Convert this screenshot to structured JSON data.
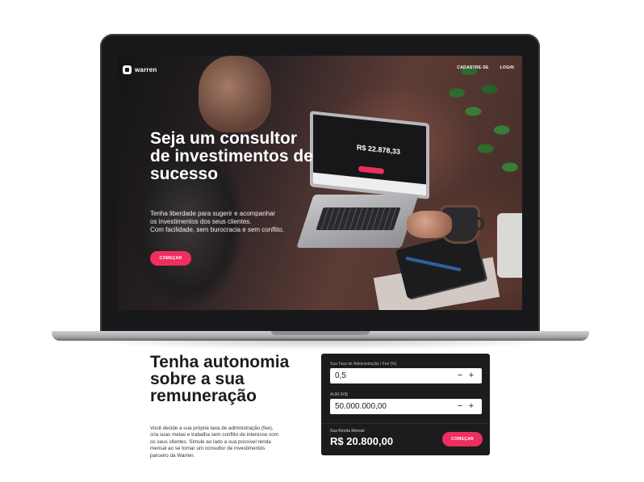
{
  "nav": {
    "brand": "warren",
    "links": [
      "CADASTRE-SE",
      "LOGIN"
    ]
  },
  "hero": {
    "title": "Seja um consultor de investimentos de sucesso",
    "description_lines": [
      "Tenha liberdade para sugerir e acompanhar",
      "os investimentos dos seus clientes.",
      "Com facilidade, sem burocracia e sem conflito."
    ],
    "cta_label": "COMEÇAR",
    "inner_screen_value": "R$ 22.878,33"
  },
  "section": {
    "title": "Tenha autonomia sobre a sua remuneração",
    "description": "Você decide a sua própria taxa de administração (fee), cria suas metas e trabalha sem conflito de interesse com os seus clientes. Simule ao lado a sua possível renda mensal ao se tornar um consultor de investimentos parceiro da Warren."
  },
  "calculator": {
    "fee_label": "Sua Taxa de Administração / Fee  (%)",
    "fee_value": "0,5",
    "aum_label": "AUM (R$)",
    "aum_value": "50.000.000,00",
    "decrement_symbol": "−",
    "increment_symbol": "+",
    "result_label": "Sua Renda Mensal",
    "result_value": "R$ 20.800,00",
    "cta_label": "COMEÇAR"
  },
  "colors": {
    "accent": "#ee2e5f",
    "panel": "#1c1c1f",
    "text_dark": "#1c1c1e"
  }
}
